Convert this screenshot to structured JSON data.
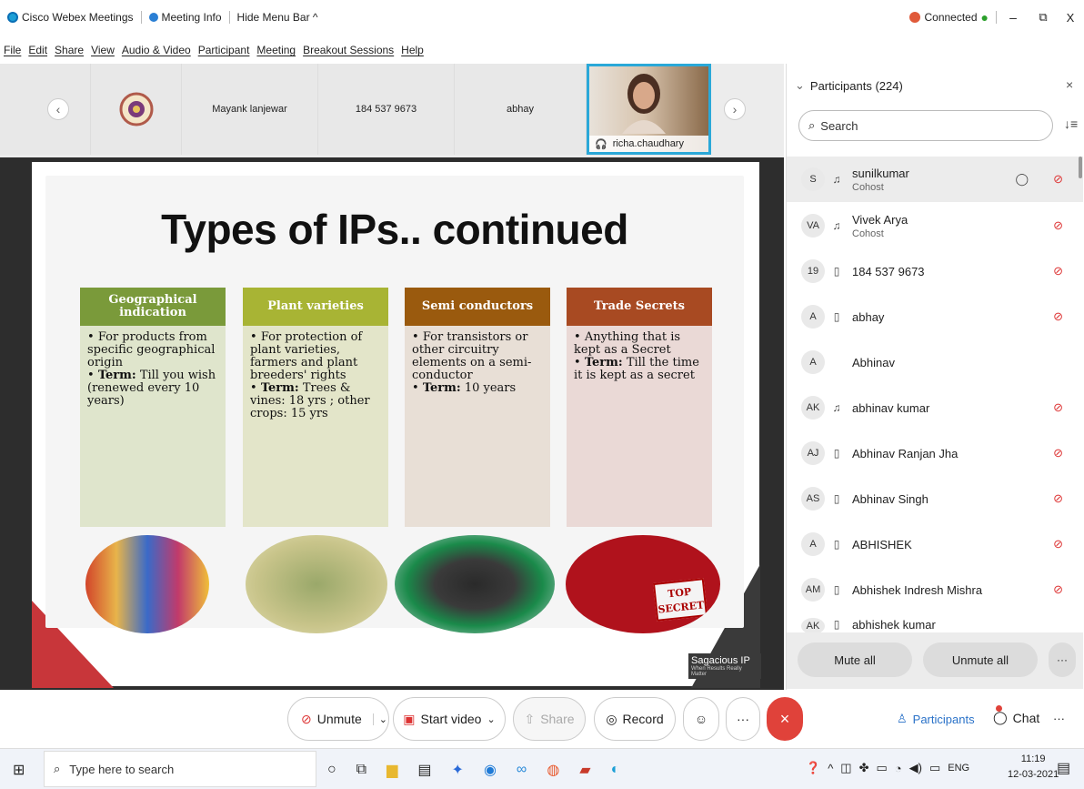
{
  "titlebar": {
    "app_name": "Cisco Webex Meetings",
    "meeting_info": "Meeting Info",
    "hide_menu": "Hide Menu Bar ^",
    "status": "Connected",
    "status_color": "#2ca02c",
    "win_min": "–",
    "win_max": "⧉",
    "win_close": "X"
  },
  "menu": [
    "File",
    "Edit",
    "Share",
    "View",
    "Audio & Video",
    "Participant",
    "Meeting",
    "Breakout Sessions",
    "Help"
  ],
  "strip": {
    "tiles": [
      "Mayank lanjewar",
      "184 537 9673",
      "abhay"
    ],
    "active_name": "richa.chaudhary",
    "prev": "‹",
    "next": "›"
  },
  "slide": {
    "title": "Types of IPs.. continued",
    "cards": [
      {
        "header": "Geographical indication",
        "color": "#7a9a3a",
        "bg": "#dfe5cc",
        "items": [
          "For products from specific geographical origin"
        ],
        "term_label": "Term:",
        "term_text": "Till you wish (renewed every 10 years)"
      },
      {
        "header": "Plant varieties",
        "color": "#a8b434",
        "bg": "#e3e5c9",
        "items": [
          "For protection of plant varieties, farmers and plant breeders' rights"
        ],
        "term_label": "Term:",
        "term_text": "Trees & vines: 18 yrs ; other crops: 15 yrs"
      },
      {
        "header": "Semi conductors",
        "color": "#9a5a0e",
        "bg": "#e8dfd6",
        "items": [
          "For transistors or other circuitry elements on a semi-conductor"
        ],
        "term_label": "Term:",
        "term_text": "10 years"
      },
      {
        "header": "Trade Secrets",
        "color": "#a84a22",
        "bg": "#ead9d6",
        "items": [
          "Anything that is kept as a Secret"
        ],
        "term_label": "Term:",
        "term_text": "Till the time it is kept as a secret"
      }
    ],
    "brand": "Sagacious IP",
    "tagline": "When Results Really Matter",
    "coke_top": "TOP",
    "coke_secret": "SECRET"
  },
  "panel": {
    "title": "Participants (224)",
    "search_placeholder": "Search",
    "participants": [
      {
        "initials": "S",
        "name": "sunilkumar",
        "role": "Cohost"
      },
      {
        "initials": "VA",
        "name": "Vivek Arya",
        "role": "Cohost"
      },
      {
        "initials": "19",
        "name": "184 537 9673",
        "role": ""
      },
      {
        "initials": "A",
        "name": "abhay",
        "role": ""
      },
      {
        "initials": "A",
        "name": "Abhinav",
        "role": ""
      },
      {
        "initials": "AK",
        "name": "abhinav kumar",
        "role": ""
      },
      {
        "initials": "AJ",
        "name": "Abhinav Ranjan Jha",
        "role": ""
      },
      {
        "initials": "AS",
        "name": "Abhinav Singh",
        "role": ""
      },
      {
        "initials": "A",
        "name": "ABHISHEK",
        "role": ""
      },
      {
        "initials": "AM",
        "name": "Abhishek Indresh Mishra",
        "role": ""
      },
      {
        "initials": "AK",
        "name": "abhishek kumar",
        "role": ""
      }
    ],
    "mute_all": "Mute all",
    "unmute_all": "Unmute all",
    "more": "···"
  },
  "controls": {
    "unmute": "Unmute",
    "start_video": "Start video",
    "share": "Share",
    "record": "Record",
    "more": "···",
    "participants": "Participants",
    "chat": "Chat",
    "end_color": "#e0423a"
  },
  "taskbar": {
    "search_placeholder": "Type here to search",
    "lang": "ENG",
    "time": "11:19",
    "date": "12-03-2021"
  }
}
